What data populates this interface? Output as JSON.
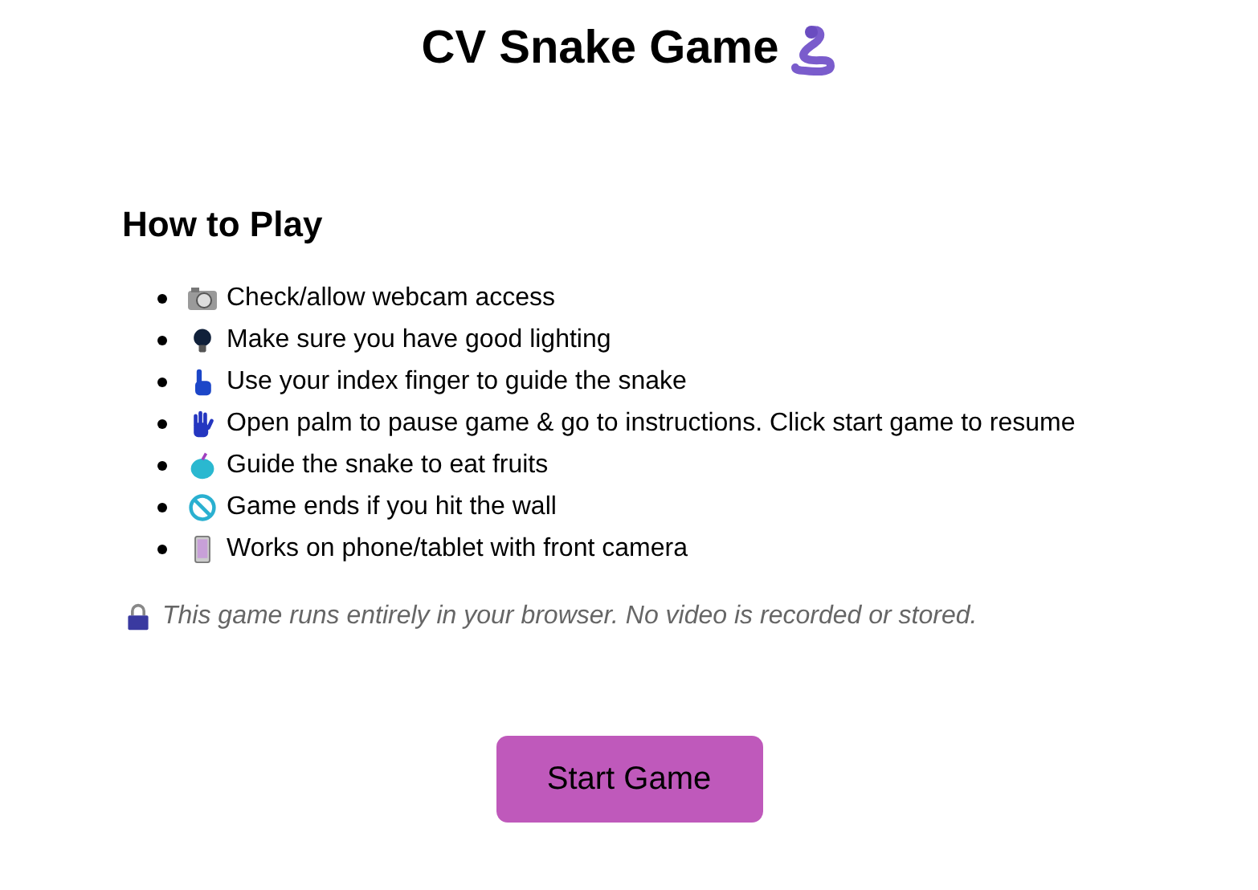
{
  "title": "CV Snake Game",
  "section_title": "How to Play",
  "instructions": [
    {
      "kind": "camera",
      "text": "Check/allow webcam access"
    },
    {
      "kind": "bulb",
      "text": "Make sure you have good lighting"
    },
    {
      "kind": "pointer",
      "text": "Use your index finger to guide the snake"
    },
    {
      "kind": "palm",
      "text": "Open palm to pause game & go to instructions. Click start game to resume"
    },
    {
      "kind": "apple",
      "text": "Guide the snake to eat fruits"
    },
    {
      "kind": "prohibited",
      "text": "Game ends if you hit the wall"
    },
    {
      "kind": "phone",
      "text": "Works on phone/tablet with front camera"
    }
  ],
  "privacy_note": "This game runs entirely in your browser. No video is recorded or stored.",
  "start_button": "Start Game"
}
